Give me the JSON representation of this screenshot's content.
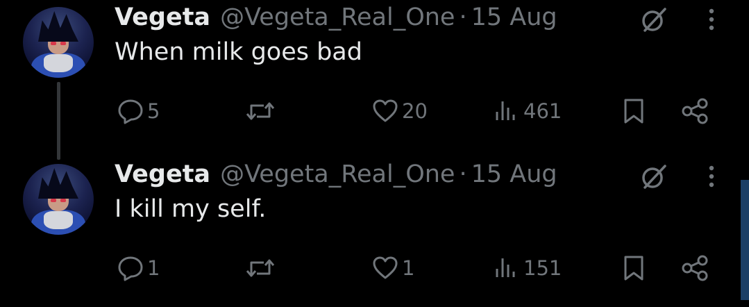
{
  "colors": {
    "background": "#000000",
    "text_primary": "#e7e9ea",
    "text_secondary": "#71767b",
    "thread_line": "#333639",
    "scroll_accent": "#1b3f66"
  },
  "icons": [
    "reply-icon",
    "retweet-icon",
    "like-icon",
    "views-icon",
    "bookmark-icon",
    "share-icon",
    "grok-icon",
    "more-icon"
  ],
  "tweets": [
    {
      "author_name": "Vegeta",
      "author_handle": "@Vegeta_Real_One",
      "separator": "·",
      "date": "15 Aug",
      "text": "When milk goes bad",
      "replies": "5",
      "retweets": "",
      "likes": "20",
      "views": "461"
    },
    {
      "author_name": "Vegeta",
      "author_handle": "@Vegeta_Real_One",
      "separator": "·",
      "date": "15 Aug",
      "text": "I kill my self.",
      "replies": "1",
      "retweets": "",
      "likes": "1",
      "views": "151"
    }
  ]
}
